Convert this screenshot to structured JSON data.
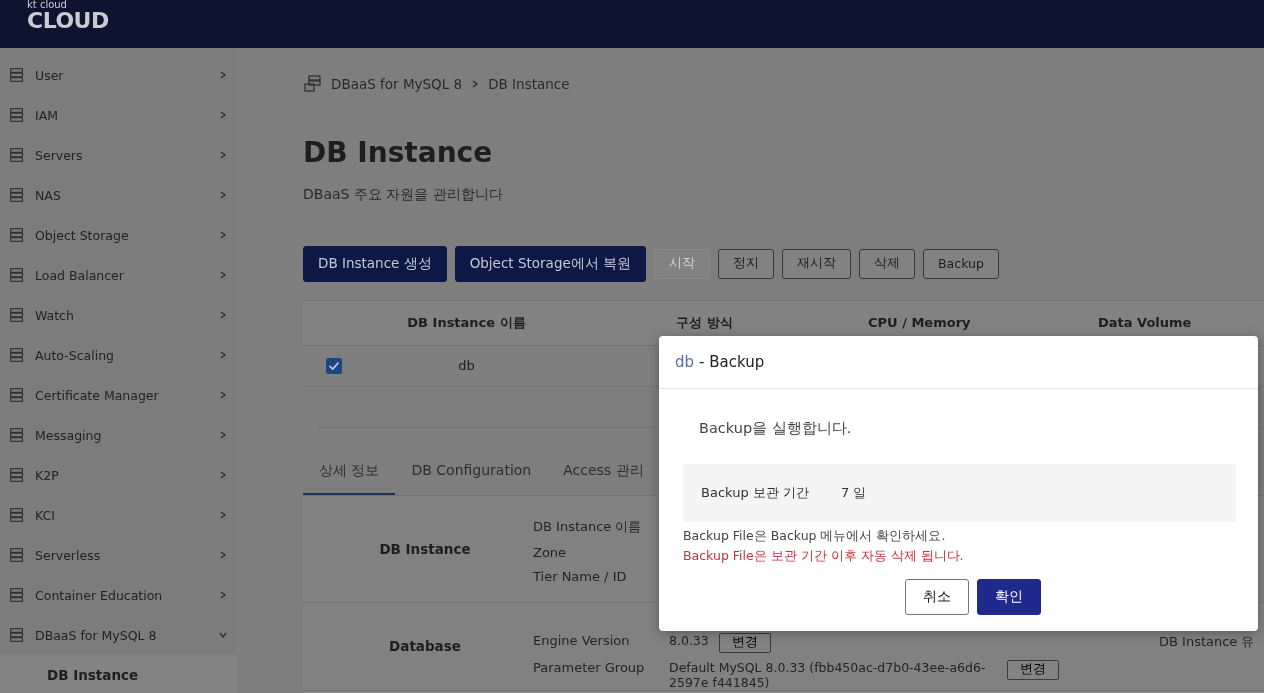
{
  "header": {
    "logo_small": "kt cloud",
    "logo": "CLOUD"
  },
  "sidebar": {
    "items": [
      {
        "label": "User",
        "expanded": false
      },
      {
        "label": "IAM",
        "expanded": false
      },
      {
        "label": "Servers",
        "expanded": false
      },
      {
        "label": "NAS",
        "expanded": false
      },
      {
        "label": "Object Storage",
        "expanded": false
      },
      {
        "label": "Load Balancer",
        "expanded": false
      },
      {
        "label": "Watch",
        "expanded": false
      },
      {
        "label": "Auto-Scaling",
        "expanded": false
      },
      {
        "label": "Certificate Manager",
        "expanded": false
      },
      {
        "label": "Messaging",
        "expanded": false
      },
      {
        "label": "K2P",
        "expanded": false
      },
      {
        "label": "KCI",
        "expanded": false
      },
      {
        "label": "Serverless",
        "expanded": false
      },
      {
        "label": "Container Education",
        "expanded": false
      },
      {
        "label": "DBaaS for MySQL 8",
        "expanded": true,
        "children": [
          {
            "label": "DB Instance",
            "selected": true
          }
        ]
      }
    ]
  },
  "breadcrumb": [
    "DBaaS for MySQL 8",
    "DB Instance"
  ],
  "page": {
    "title": "DB Instance",
    "subtitle": "DBaaS 주요 자원을 관리합니다"
  },
  "toolbar": [
    {
      "label": "DB Instance 생성",
      "kind": "primary",
      "disabled": false
    },
    {
      "label": "Object Storage에서 복원",
      "kind": "primary",
      "disabled": false
    },
    {
      "label": "시작",
      "kind": "outline",
      "disabled": true
    },
    {
      "label": "정지",
      "kind": "outline",
      "disabled": false
    },
    {
      "label": "재시작",
      "kind": "outline",
      "disabled": false
    },
    {
      "label": "삭제",
      "kind": "outline",
      "disabled": false
    },
    {
      "label": "Backup",
      "kind": "outline",
      "disabled": false
    }
  ],
  "table": {
    "columns": [
      "DB Instance 이름",
      "구성 방식",
      "CPU / Memory",
      "Data Volume"
    ],
    "rows": [
      {
        "checked": true,
        "cells": [
          "db"
        ]
      }
    ]
  },
  "detail_tabs": [
    {
      "label": "상세 정보",
      "selected": true
    },
    {
      "label": "DB Configuration",
      "selected": false
    },
    {
      "label": "Access 관리",
      "selected": false
    }
  ],
  "details": [
    {
      "title": "DB Instance",
      "fields": [
        {
          "label": "DB Instance 이름"
        },
        {
          "label": "Zone"
        },
        {
          "label": "Tier Name / ID"
        }
      ]
    },
    {
      "title": "Database",
      "fields": [
        {
          "label": "Engine Version",
          "value": "8.0.33",
          "button": "변경",
          "side_label": "DB Instance 유"
        },
        {
          "label": "Parameter Group",
          "value": "Default MySQL 8.0.33 (fbb450ac-d7b0-43ee-a6d6-2597e f441845)",
          "button": "변경"
        }
      ]
    }
  ],
  "dialog": {
    "title_name": "db",
    "title": "- Backup",
    "message": "Backup을 실행합니다.",
    "info": [
      {
        "label": "Backup 보관 기간",
        "value": "7 일"
      }
    ],
    "notes": [
      {
        "text": "Backup File은 Backup 메뉴에서 확인하세요.",
        "kind": "info"
      },
      {
        "text": "Backup File은 보관 기간 이후 자동 삭제 됩니다.",
        "kind": "warning"
      }
    ],
    "buttons": [
      {
        "label": "취소",
        "kind": "outline"
      },
      {
        "label": "확인",
        "kind": "primary"
      }
    ]
  }
}
